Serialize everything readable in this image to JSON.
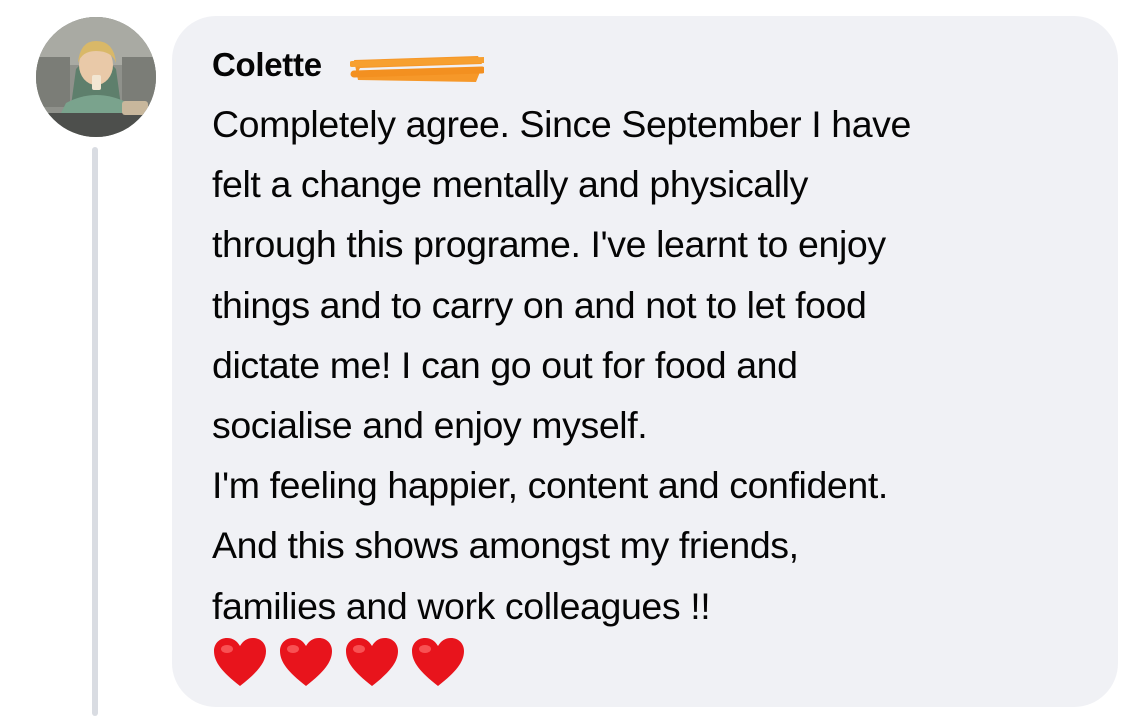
{
  "comment": {
    "author": "Colette",
    "lines": [
      "Completely agree. Since September I have",
      "felt a change mentally and physically",
      "through this programe. I've learnt to enjoy",
      "things and to carry on and not to let food",
      "dictate me! I can go out for food and",
      "socialise and enjoy myself.",
      "I'm feeling happier, content and confident.",
      "And this shows amongst my friends,",
      "families and work colleagues !!"
    ],
    "emojis": [
      "red-heart",
      "red-heart",
      "red-heart",
      "red-heart"
    ]
  },
  "colors": {
    "bubble_background": "#f0f1f5",
    "text": "#050505",
    "thread_line": "#d9dce2",
    "redaction_highlight": "#f5921e",
    "heart": "#e8141c"
  }
}
